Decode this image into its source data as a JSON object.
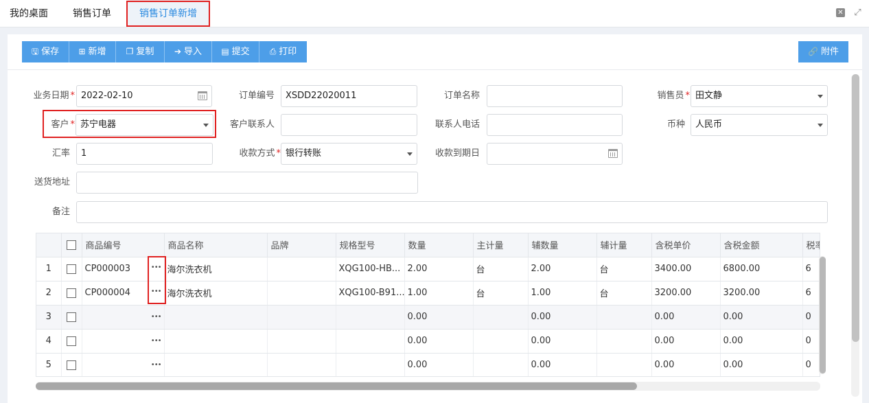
{
  "tabs": [
    {
      "label": "我的桌面"
    },
    {
      "label": "销售订单"
    },
    {
      "label": "销售订单新增"
    }
  ],
  "toolbar": {
    "save": "保存",
    "add": "新增",
    "copy": "复制",
    "import": "导入",
    "submit": "提交",
    "print": "打印",
    "attach": "附件"
  },
  "form": {
    "biz_date_label": "业务日期",
    "biz_date": "2022-02-10",
    "order_no_label": "订单编号",
    "order_no": "XSDD22020011",
    "order_name_label": "订单名称",
    "order_name": "",
    "salesman_label": "销售员",
    "salesman": "田文静",
    "customer_label": "客户",
    "customer": "苏宁电器",
    "contact_label": "客户联系人",
    "contact": "",
    "contact_phone_label": "联系人电话",
    "contact_phone": "",
    "currency_label": "币种",
    "currency": "人民币",
    "rate_label": "汇率",
    "rate": "1",
    "pay_method_label": "收款方式",
    "pay_method": "银行转账",
    "due_date_label": "收款到期日",
    "due_date": "",
    "address_label": "送货地址",
    "address": "",
    "remark_label": "备注",
    "remark": ""
  },
  "grid": {
    "headers": [
      "商品编号",
      "商品名称",
      "品牌",
      "规格型号",
      "数量",
      "主计量",
      "辅数量",
      "辅计量",
      "含税单价",
      "含税金额",
      "税率%"
    ],
    "rows": [
      {
        "no": "1",
        "code": "CP000003",
        "name": "海尔洗衣机",
        "brand": "",
        "spec": "XQG100-HB...",
        "qty": "2.00",
        "unit": "台",
        "aux_qty": "2.00",
        "aux_unit": "台",
        "price": "3400.00",
        "amount": "6800.00",
        "tax": "6"
      },
      {
        "no": "2",
        "code": "CP000004",
        "name": "海尔洗衣机",
        "brand": "",
        "spec": "XQG100-B91...",
        "qty": "1.00",
        "unit": "台",
        "aux_qty": "1.00",
        "aux_unit": "台",
        "price": "3200.00",
        "amount": "3200.00",
        "tax": "6"
      },
      {
        "no": "3",
        "code": "",
        "name": "",
        "brand": "",
        "spec": "",
        "qty": "0.00",
        "unit": "",
        "aux_qty": "0.00",
        "aux_unit": "",
        "price": "0.00",
        "amount": "0.00",
        "tax": "0"
      },
      {
        "no": "4",
        "code": "",
        "name": "",
        "brand": "",
        "spec": "",
        "qty": "0.00",
        "unit": "",
        "aux_qty": "0.00",
        "aux_unit": "",
        "price": "0.00",
        "amount": "0.00",
        "tax": "0"
      },
      {
        "no": "5",
        "code": "",
        "name": "",
        "brand": "",
        "spec": "",
        "qty": "0.00",
        "unit": "",
        "aux_qty": "0.00",
        "aux_unit": "",
        "price": "0.00",
        "amount": "0.00",
        "tax": "0"
      }
    ],
    "ellipsis": "•••"
  }
}
